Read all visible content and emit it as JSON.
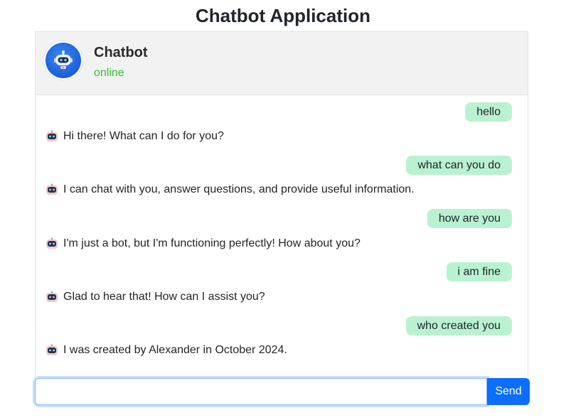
{
  "page": {
    "title": "Chatbot Application"
  },
  "header": {
    "bot_name": "Chatbot",
    "status": "online",
    "avatar_icon": "robot-avatar-icon",
    "status_color": "#2fbf2f"
  },
  "messages": [
    {
      "sender": "user",
      "text": "hello"
    },
    {
      "sender": "bot",
      "text": "Hi there! What can I do for you?",
      "icon": "robot-icon"
    },
    {
      "sender": "user",
      "text": "what can you do"
    },
    {
      "sender": "bot",
      "text": "I can chat with you, answer questions, and provide useful information.",
      "icon": "robot-icon"
    },
    {
      "sender": "user",
      "text": "how are you"
    },
    {
      "sender": "bot",
      "text": "I'm just a bot, but I'm functioning perfectly! How about you?",
      "icon": "robot-icon"
    },
    {
      "sender": "user",
      "text": "i am fine"
    },
    {
      "sender": "bot",
      "text": "Glad to hear that! How can I assist you?",
      "icon": "robot-icon"
    },
    {
      "sender": "user",
      "text": "who created you"
    },
    {
      "sender": "bot",
      "text": "I was created by Alexander in October 2024.",
      "icon": "robot-icon"
    }
  ],
  "composer": {
    "input_value": "",
    "input_placeholder": "",
    "send_label": "Send"
  },
  "colors": {
    "user_bubble": "#b9f2d0",
    "send_button": "#0d6efd",
    "header_bg": "#f2f2f2"
  }
}
